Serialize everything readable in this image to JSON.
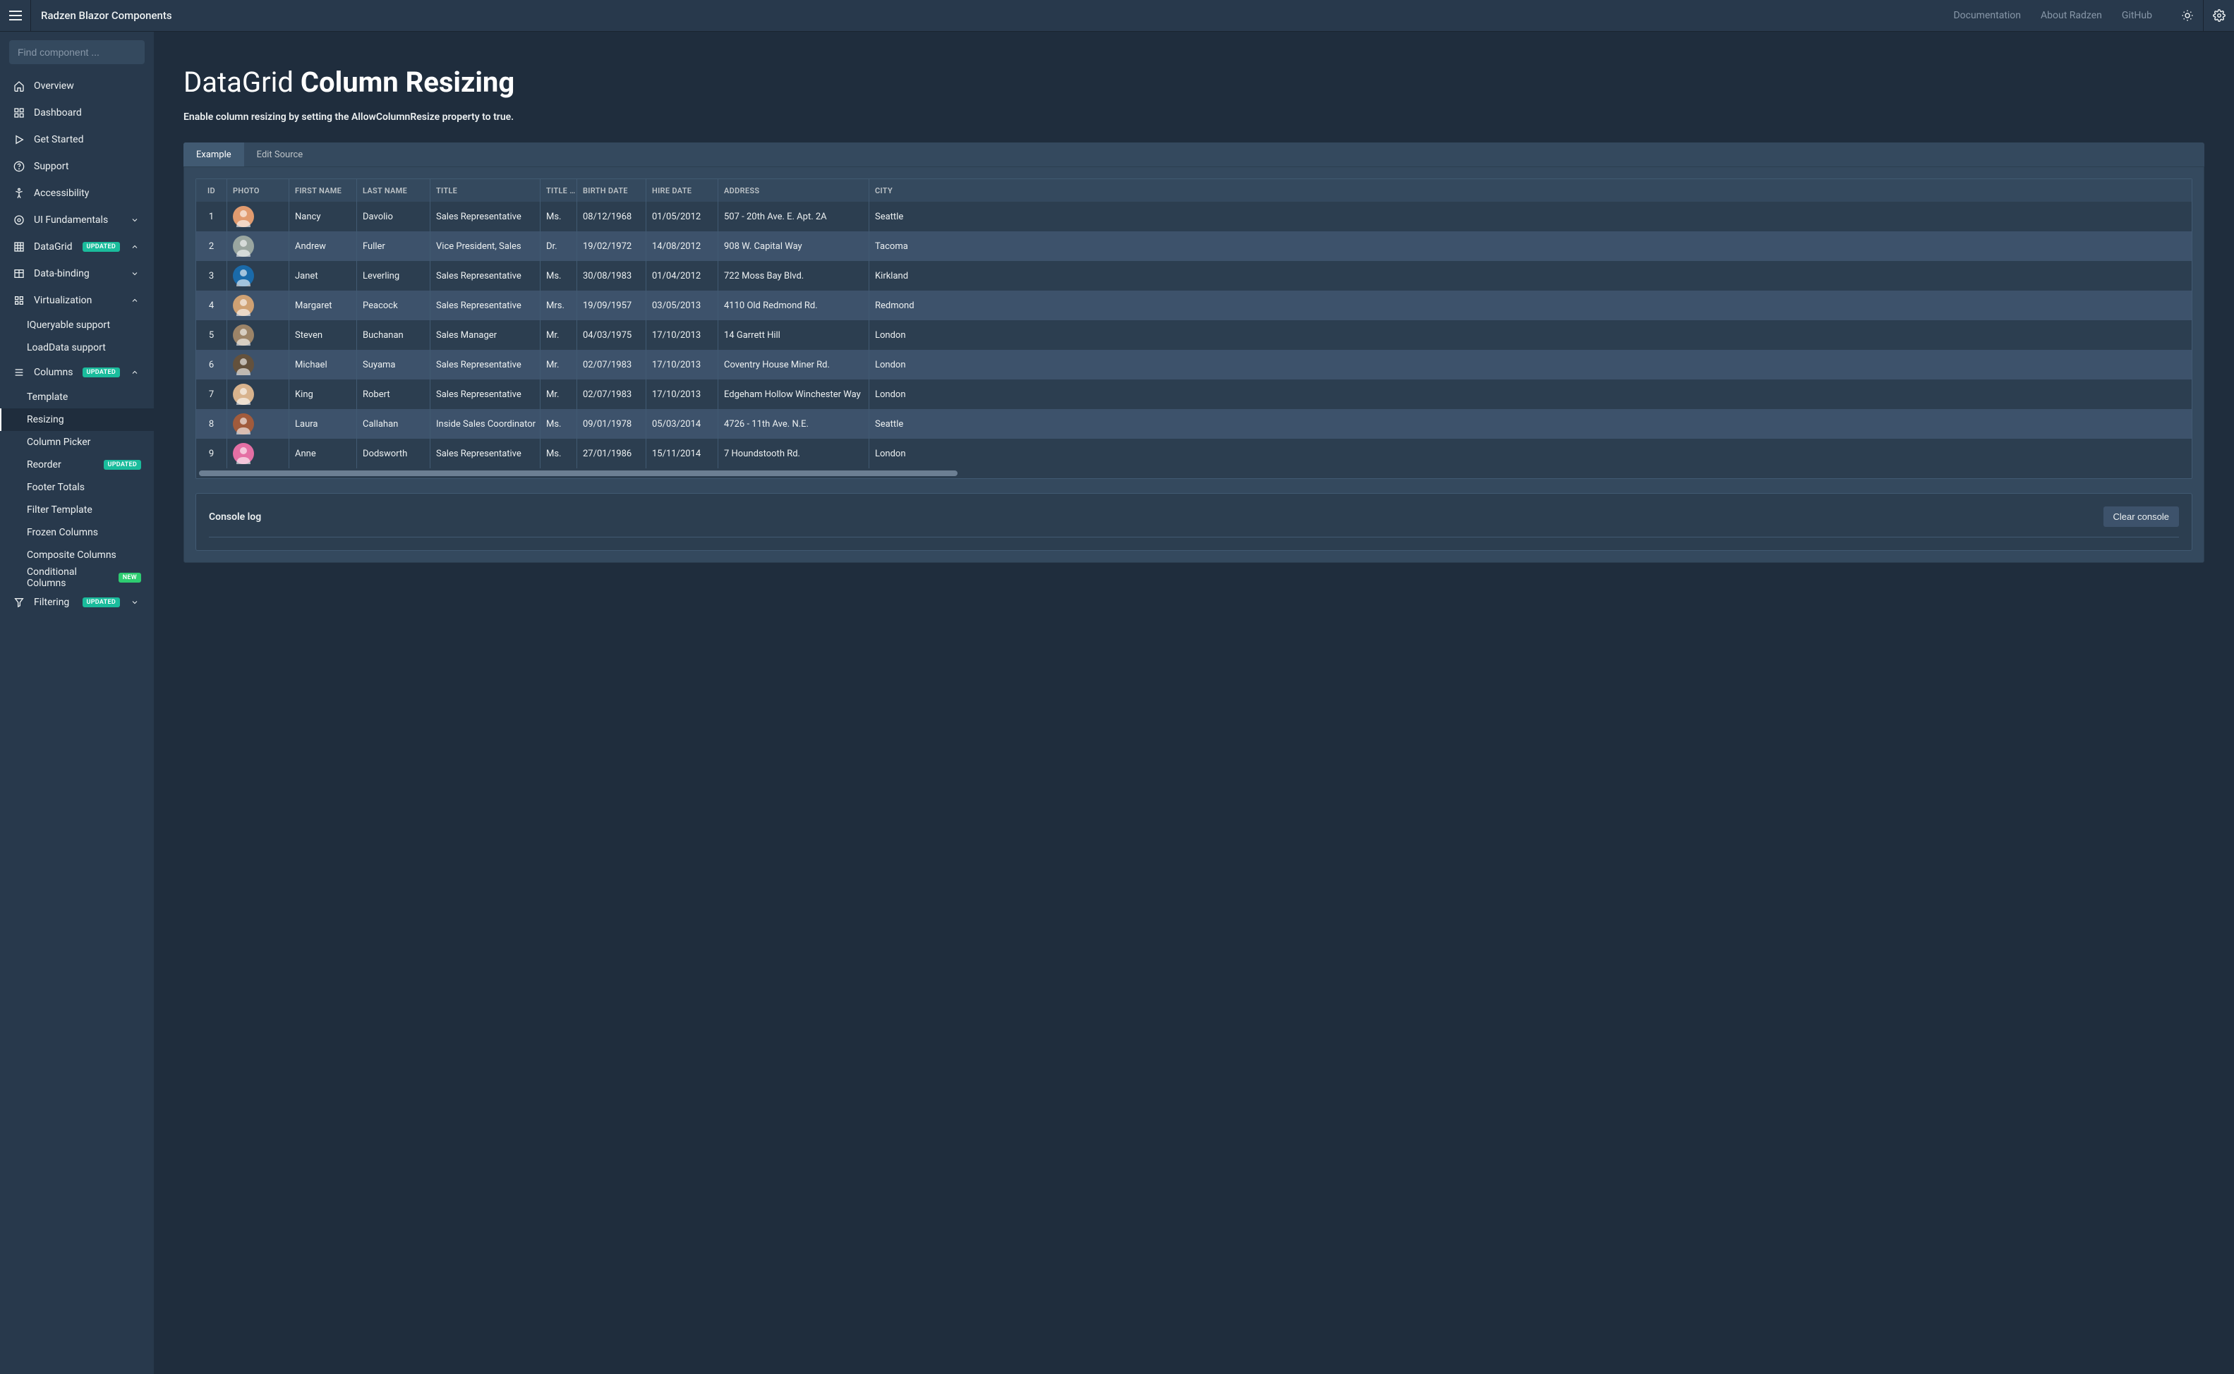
{
  "topbar": {
    "title": "Radzen Blazor Components",
    "links": [
      "Documentation",
      "About Radzen",
      "GitHub"
    ]
  },
  "search": {
    "placeholder": "Find component ..."
  },
  "sidebar": [
    {
      "label": "Overview",
      "icon": "home"
    },
    {
      "label": "Dashboard",
      "icon": "dashboard"
    },
    {
      "label": "Get Started",
      "icon": "play"
    },
    {
      "label": "Support",
      "icon": "help"
    },
    {
      "label": "Accessibility",
      "icon": "accessibility"
    },
    {
      "label": "UI Fundamentals",
      "icon": "tune",
      "expandable": true,
      "open": false
    },
    {
      "label": "DataGrid",
      "icon": "grid",
      "badge": "UPDATED",
      "badgeType": "updated",
      "expandable": true,
      "open": true
    },
    {
      "label": "Data-binding",
      "icon": "table",
      "indent": 1,
      "expandable": true,
      "open": false
    },
    {
      "label": "Virtualization",
      "icon": "layers",
      "indent": 1,
      "expandable": true,
      "open": true
    },
    {
      "label": "IQueryable support",
      "indent": 2
    },
    {
      "label": "LoadData support",
      "indent": 2
    },
    {
      "label": "Columns",
      "icon": "columns",
      "indent": 1,
      "badge": "UPDATED",
      "badgeType": "updated",
      "expandable": true,
      "open": true
    },
    {
      "label": "Template",
      "indent": 2
    },
    {
      "label": "Resizing",
      "indent": 2,
      "active": true
    },
    {
      "label": "Column Picker",
      "indent": 2
    },
    {
      "label": "Reorder",
      "indent": 2,
      "badge": "UPDATED",
      "badgeType": "updated"
    },
    {
      "label": "Footer Totals",
      "indent": 2
    },
    {
      "label": "Filter Template",
      "indent": 2
    },
    {
      "label": "Frozen Columns",
      "indent": 2
    },
    {
      "label": "Composite Columns",
      "indent": 2
    },
    {
      "label": "Conditional Columns",
      "indent": 2,
      "badge": "NEW",
      "badgeType": "new"
    },
    {
      "label": "Filtering",
      "icon": "filter",
      "indent": 1,
      "badge": "UPDATED",
      "badgeType": "updated",
      "expandable": true,
      "open": false
    }
  ],
  "page": {
    "title_pre": "DataGrid ",
    "title_strong": "Column Resizing",
    "subtitle": "Enable column resizing by setting the AllowColumnResize property to true."
  },
  "tabs": [
    {
      "label": "Example",
      "active": true
    },
    {
      "label": "Edit Source",
      "active": false
    }
  ],
  "columns": [
    "ID",
    "PHOTO",
    "FIRST NAME",
    "LAST NAME",
    "TITLE",
    "TITLE …",
    "BIRTH DATE",
    "HIRE DATE",
    "ADDRESS",
    "CITY"
  ],
  "rows": [
    {
      "id": "1",
      "avatar": "#e19b6f",
      "fname": "Nancy",
      "lname": "Davolio",
      "title": "Sales Representative",
      "toc": "Ms.",
      "bdate": "08/12/1968",
      "hdate": "01/05/2012",
      "addr": "507 - 20th Ave. E. Apt. 2A",
      "city": "Seattle"
    },
    {
      "id": "2",
      "avatar": "#9aa6a0",
      "fname": "Andrew",
      "lname": "Fuller",
      "title": "Vice President, Sales",
      "toc": "Dr.",
      "bdate": "19/02/1972",
      "hdate": "14/08/2012",
      "addr": "908 W. Capital Way",
      "city": "Tacoma"
    },
    {
      "id": "3",
      "avatar": "#1a6aa9",
      "fname": "Janet",
      "lname": "Leverling",
      "title": "Sales Representative",
      "toc": "Ms.",
      "bdate": "30/08/1983",
      "hdate": "01/04/2012",
      "addr": "722 Moss Bay Blvd.",
      "city": "Kirkland"
    },
    {
      "id": "4",
      "avatar": "#cfa173",
      "fname": "Margaret",
      "lname": "Peacock",
      "title": "Sales Representative",
      "toc": "Mrs.",
      "bdate": "19/09/1957",
      "hdate": "03/05/2013",
      "addr": "4110 Old Redmond Rd.",
      "city": "Redmond"
    },
    {
      "id": "5",
      "avatar": "#9c8468",
      "fname": "Steven",
      "lname": "Buchanan",
      "title": "Sales Manager",
      "toc": "Mr.",
      "bdate": "04/03/1975",
      "hdate": "17/10/2013",
      "addr": "14 Garrett Hill",
      "city": "London"
    },
    {
      "id": "6",
      "avatar": "#63513d",
      "fname": "Michael",
      "lname": "Suyama",
      "title": "Sales Representative",
      "toc": "Mr.",
      "bdate": "02/07/1983",
      "hdate": "17/10/2013",
      "addr": "Coventry House Miner Rd.",
      "city": "London"
    },
    {
      "id": "7",
      "avatar": "#d8b38d",
      "fname": "King",
      "lname": "Robert",
      "title": "Sales Representative",
      "toc": "Mr.",
      "bdate": "02/07/1983",
      "hdate": "17/10/2013",
      "addr": "Edgeham Hollow Winchester Way",
      "city": "London"
    },
    {
      "id": "8",
      "avatar": "#a15b3c",
      "fname": "Laura",
      "lname": "Callahan",
      "title": "Inside Sales Coordinator",
      "toc": "Ms.",
      "bdate": "09/01/1978",
      "hdate": "05/03/2014",
      "addr": "4726 - 11th Ave. N.E.",
      "city": "Seattle"
    },
    {
      "id": "9",
      "avatar": "#e46fa4",
      "fname": "Anne",
      "lname": "Dodsworth",
      "title": "Sales Representative",
      "toc": "Ms.",
      "bdate": "27/01/1986",
      "hdate": "15/11/2014",
      "addr": "7 Houndstooth Rd.",
      "city": "London"
    }
  ],
  "console": {
    "title": "Console log",
    "clear": "Clear console"
  }
}
